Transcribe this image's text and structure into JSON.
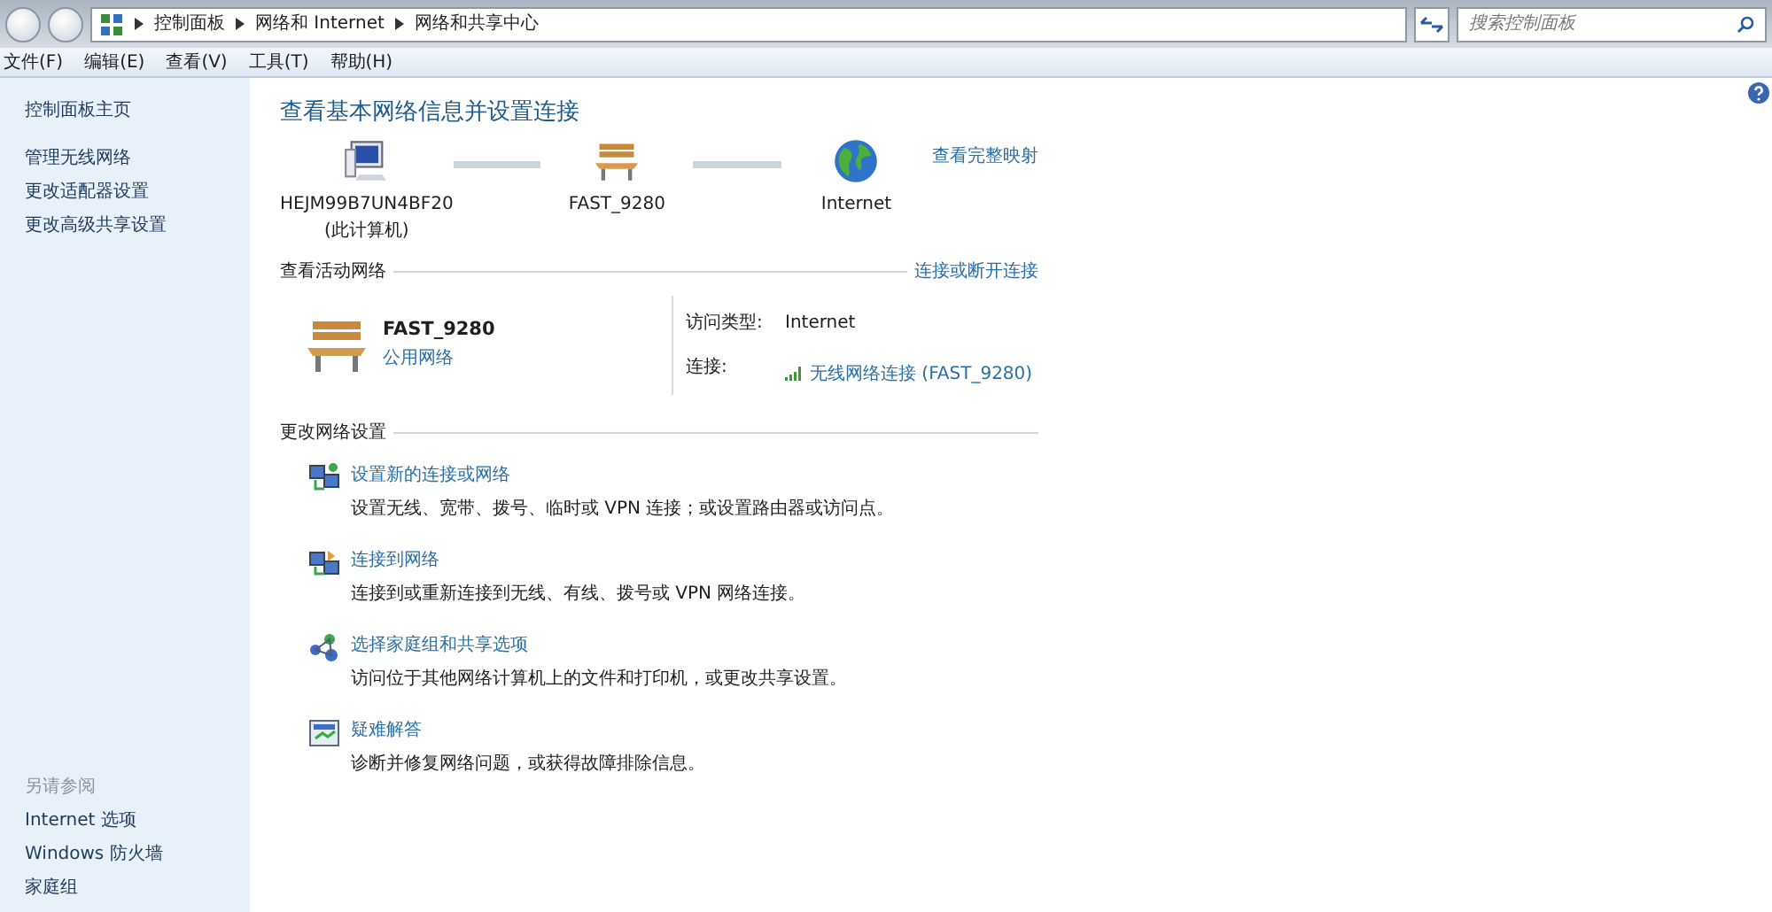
{
  "address_bar": {
    "breadcrumb": [
      "控制面板",
      "网络和 Internet",
      "网络和共享中心"
    ],
    "search_placeholder": "搜索控制面板"
  },
  "menu": [
    "文件(F)",
    "编辑(E)",
    "查看(V)",
    "工具(T)",
    "帮助(H)"
  ],
  "sidebar": {
    "items": [
      "控制面板主页",
      "管理无线网络",
      "更改适配器设置",
      "更改高级共享设置"
    ],
    "see_also_title": "另请参阅",
    "see_also": [
      "Internet 选项",
      "Windows 防火墙",
      "家庭组"
    ]
  },
  "page_title": "查看基本网络信息并设置连接",
  "network_map": {
    "nodes": [
      {
        "kind": "computer",
        "label": "HEJM99B7UN4BF20",
        "sublabel": "(此计算机)"
      },
      {
        "kind": "bench",
        "label": "FAST_9280"
      },
      {
        "kind": "globe",
        "label": "Internet"
      }
    ],
    "full_map_link": "查看完整映射"
  },
  "active_networks": {
    "title": "查看活动网络",
    "link": "连接或断开连接",
    "name": "FAST_9280",
    "type": "公用网络",
    "access_label": "访问类型:",
    "access_value": "Internet",
    "connection_label": "连接:",
    "connection_value": "无线网络连接 (FAST_9280)"
  },
  "change_settings": {
    "title": "更改网络设置",
    "tasks": [
      {
        "kind": "new-connection",
        "link": "设置新的连接或网络",
        "desc": "设置无线、宽带、拨号、临时或 VPN 连接；或设置路由器或访问点。"
      },
      {
        "kind": "connect",
        "link": "连接到网络",
        "desc": "连接到或重新连接到无线、有线、拨号或 VPN 网络连接。"
      },
      {
        "kind": "homegroup",
        "link": "选择家庭组和共享选项",
        "desc": "访问位于其他网络计算机上的文件和打印机，或更改共享设置。"
      },
      {
        "kind": "troubleshoot",
        "link": "疑难解答",
        "desc": "诊断并修复网络问题，或获得故障排除信息。"
      }
    ]
  }
}
